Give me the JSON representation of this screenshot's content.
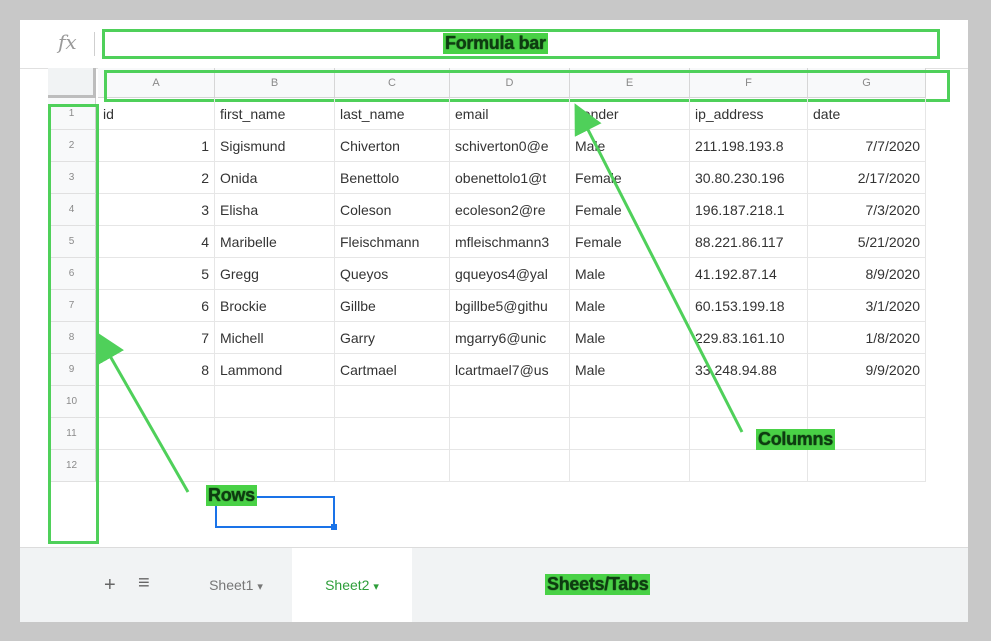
{
  "formula_bar": {
    "fx_symbol": "fx"
  },
  "annotations": {
    "formula_bar": "Formula bar",
    "columns": "Columns",
    "rows": "Rows",
    "sheets_tabs": "Sheets/Tabs"
  },
  "columns": [
    "A",
    "B",
    "C",
    "D",
    "E",
    "F",
    "G"
  ],
  "rows": [
    "1",
    "2",
    "3",
    "4",
    "5",
    "6",
    "7",
    "8",
    "9",
    "10",
    "11",
    "12"
  ],
  "table": {
    "header": [
      "id",
      "first_name",
      "last_name",
      "email",
      "gender",
      "ip_address",
      "date"
    ],
    "records": [
      [
        "1",
        "Sigismund",
        "Chiverton",
        "schiverton0@e",
        "Male",
        "211.198.193.8",
        "7/7/2020"
      ],
      [
        "2",
        "Onida",
        "Benettolo",
        "obenettolo1@t",
        "Female",
        "30.80.230.196",
        "2/17/2020"
      ],
      [
        "3",
        "Elisha",
        "Coleson",
        "ecoleson2@re",
        "Female",
        "196.187.218.1",
        "7/3/2020"
      ],
      [
        "4",
        "Maribelle",
        "Fleischmann",
        "mfleischmann3",
        "Female",
        "88.221.86.117",
        "5/21/2020"
      ],
      [
        "5",
        "Gregg",
        "Queyos",
        "gqueyos4@yal",
        "Male",
        "41.192.87.14",
        "8/9/2020"
      ],
      [
        "6",
        "Brockie",
        "Gillbe",
        "bgillbe5@githu",
        "Male",
        "60.153.199.18",
        "3/1/2020"
      ],
      [
        "7",
        "Michell",
        "Garry",
        "mgarry6@unic",
        "Male",
        "229.83.161.10",
        "1/8/2020"
      ],
      [
        "8",
        "Lammond",
        "Cartmael",
        "lcartmael7@us",
        "Male",
        "33.248.94.88",
        "9/9/2020"
      ]
    ]
  },
  "tabs": {
    "add_symbol": "+",
    "list_symbol": "≡",
    "sheet1": "Sheet1",
    "sheet2": "Sheet2",
    "dropdown_symbol": "▾"
  },
  "colors": {
    "annotation_green": "#4fd05a",
    "active_tab": "#2e9e3a",
    "selection": "#1a73e8"
  }
}
